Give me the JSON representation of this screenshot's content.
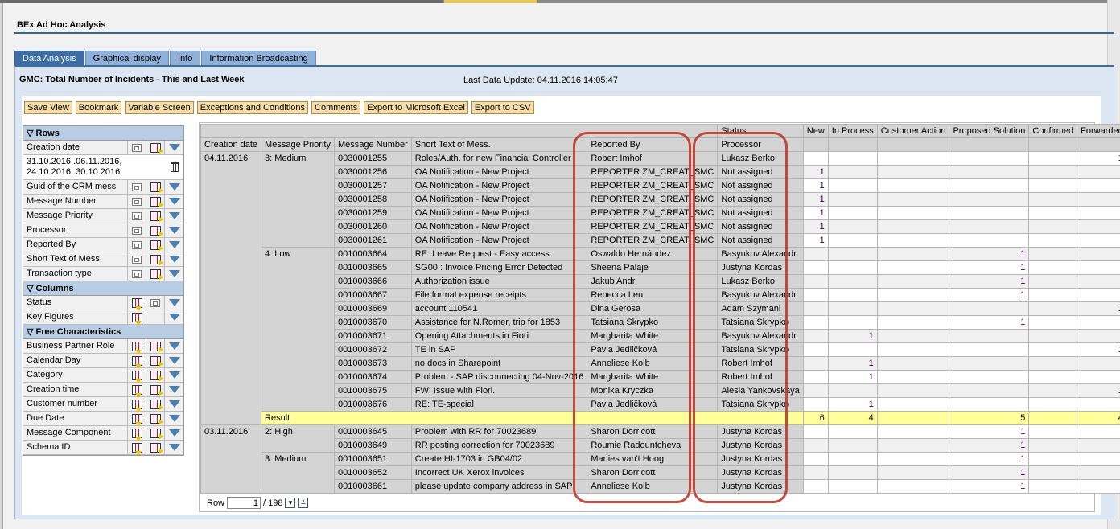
{
  "app_title": "BEx Ad Hoc Analysis",
  "tabs": [
    {
      "label": "Data Analysis",
      "active": true
    },
    {
      "label": "Graphical display"
    },
    {
      "label": "Info"
    },
    {
      "label": "Information Broadcasting"
    }
  ],
  "query_title": "GMC: Total Number of Incidents - This and Last Week",
  "last_update": "Last Data Update: 04.11.2016 14:05:47",
  "toolbar": [
    "Save View",
    "Bookmark",
    "Variable Screen",
    "Exceptions and Conditions",
    "Comments",
    "Export to Microsoft Excel",
    "Export to CSV"
  ],
  "nav": {
    "rows_label": "Rows",
    "rows": [
      "Creation date",
      "Guid of the CRM mess",
      "Message Number",
      "Message Priority",
      "Processor",
      "Reported By",
      "Short Text of Mess.",
      "Transaction type"
    ],
    "creation_filter": [
      "31.10.2016..06.11.2016,",
      "24.10.2016..30.10.2016"
    ],
    "columns_label": "Columns",
    "columns": [
      "Status",
      "Key Figures"
    ],
    "free_label": "Free Characteristics",
    "free": [
      "Business Partner Role",
      "Calendar Day",
      "Category",
      "Creation time",
      "Customer number",
      "Due Date",
      "Message Component",
      "Schema ID"
    ]
  },
  "grid": {
    "status_label": "Status",
    "row_headers": [
      "Creation date",
      "Message Priority",
      "Message Number",
      "Short Text of Mess.",
      "Reported By",
      "Processor"
    ],
    "status_columns": [
      "New",
      "In Process",
      "Customer Action",
      "Proposed Solution",
      "Confirmed",
      "Forwarded"
    ],
    "result_label": "Result",
    "groups": [
      {
        "date": "04.11.2016",
        "priorities": [
          {
            "priority": "3: Medium",
            "rows": [
              [
                "0030001255",
                "Roles/Auth. for new Financial Controller",
                "Robert Imhof",
                "Lukasz Berko",
                [
                  "",
                  "",
                  "",
                  "",
                  "",
                  "1"
                ]
              ],
              [
                "0030001256",
                "OA Notification - New Project",
                "REPORTER ZM_CREAT_SMC",
                "Not assigned",
                [
                  "1",
                  "",
                  "",
                  "",
                  "",
                  ""
                ]
              ],
              [
                "0030001257",
                "OA Notification - New Project",
                "REPORTER ZM_CREAT_SMC",
                "Not assigned",
                [
                  "1",
                  "",
                  "",
                  "",
                  "",
                  ""
                ]
              ],
              [
                "0030001258",
                "OA Notification - New Project",
                "REPORTER ZM_CREAT_SMC",
                "Not assigned",
                [
                  "1",
                  "",
                  "",
                  "",
                  "",
                  ""
                ]
              ],
              [
                "0030001259",
                "OA Notification - New Project",
                "REPORTER ZM_CREAT_SMC",
                "Not assigned",
                [
                  "1",
                  "",
                  "",
                  "",
                  "",
                  ""
                ]
              ],
              [
                "0030001260",
                "OA Notification - New Project",
                "REPORTER ZM_CREAT_SMC",
                "Not assigned",
                [
                  "1",
                  "",
                  "",
                  "",
                  "",
                  ""
                ]
              ],
              [
                "0030001261",
                "OA Notification - New Project",
                "REPORTER ZM_CREAT_SMC",
                "Not assigned",
                [
                  "1",
                  "",
                  "",
                  "",
                  "",
                  ""
                ]
              ]
            ]
          },
          {
            "priority": "4: Low",
            "rows": [
              [
                "0010003664",
                "RE: Leave Request - Easy access",
                "Oswaldo Hernández",
                "Basyukov Alexandr",
                [
                  "",
                  "",
                  "",
                  "1",
                  "",
                  ""
                ]
              ],
              [
                "0010003665",
                "SG00 : Invoice Pricing Error Detected",
                "Sheena Palaje",
                "Justyna Kordas",
                [
                  "",
                  "",
                  "",
                  "1",
                  "",
                  ""
                ]
              ],
              [
                "0010003666",
                "Authorization issue",
                "Jakub Andr",
                "Lukasz Berko",
                [
                  "",
                  "",
                  "",
                  "1",
                  "",
                  ""
                ]
              ],
              [
                "0010003667",
                "File format expense receipts",
                "Rebecca Leu",
                "Basyukov Alexandr",
                [
                  "",
                  "",
                  "",
                  "1",
                  "",
                  ""
                ]
              ],
              [
                "0010003669",
                "account 110541",
                "Dina Gerosa",
                "Adam Szymani",
                [
                  "",
                  "",
                  "",
                  "",
                  "",
                  "1"
                ]
              ],
              [
                "0010003670",
                "Assistance for N.Romer, trip for 1853",
                "Tatsiana Skrypko",
                "Tatsiana Skrypko",
                [
                  "",
                  "",
                  "",
                  "1",
                  "",
                  ""
                ]
              ],
              [
                "0010003671",
                "Opening Attachments in Fiori",
                "Margharita White",
                "Basyukov Alexandr",
                [
                  "",
                  "1",
                  "",
                  "",
                  "",
                  ""
                ]
              ],
              [
                "0010003672",
                "TE in SAP",
                "Pavla Jedličková",
                "Tatsiana Skrypko",
                [
                  "",
                  "",
                  "",
                  "",
                  "",
                  "1"
                ]
              ],
              [
                "0010003673",
                "no docs in Sharepoint",
                "Anneliese Kolb",
                "Robert Imhof",
                [
                  "",
                  "1",
                  "",
                  "",
                  "",
                  ""
                ]
              ],
              [
                "0010003674",
                "Problem - SAP disconnecting 04-Nov-2016",
                "Margharita White",
                "Robert Imhof",
                [
                  "",
                  "1",
                  "",
                  "",
                  "",
                  ""
                ]
              ],
              [
                "0010003675",
                "FW: Issue with Fiori.",
                "Monika Kryczka",
                "Alesia Yankovskaya",
                [
                  "",
                  "",
                  "",
                  "",
                  "",
                  "1"
                ]
              ],
              [
                "0010003676",
                "RE: TE-special",
                "Pavla Jedličková",
                "Tatsiana Skrypko",
                [
                  "",
                  "1",
                  "",
                  "",
                  "",
                  ""
                ]
              ]
            ]
          }
        ],
        "result": [
          "6",
          "4",
          "",
          "5",
          "",
          "4"
        ]
      },
      {
        "date": "03.11.2016",
        "priorities": [
          {
            "priority": "2: High",
            "rows": [
              [
                "0010003645",
                "Problem with RR for 70023689",
                "Sharon Dorricott",
                "Justyna Kordas",
                [
                  "",
                  "",
                  "",
                  "1",
                  "",
                  ""
                ]
              ],
              [
                "0010003649",
                "RR posting correction for 70023689",
                "Roumie Radountcheva",
                "Justyna Kordas",
                [
                  "",
                  "",
                  "",
                  "1",
                  "",
                  ""
                ]
              ]
            ]
          },
          {
            "priority": "3: Medium",
            "rows": [
              [
                "0010003651",
                "Create HI-1703 in GB04/02",
                "Marlies van't Hoog",
                "Justyna Kordas",
                [
                  "",
                  "",
                  "",
                  "1",
                  "",
                  ""
                ]
              ],
              [
                "0010003652",
                "Incorrect UK Xerox invoices",
                "Sharon Dorricott",
                "Justyna Kordas",
                [
                  "",
                  "",
                  "",
                  "1",
                  "",
                  ""
                ]
              ],
              [
                "0010003661",
                "please update company address in SAP",
                "Anneliese Kolb",
                "Justyna Kordas",
                [
                  "",
                  "",
                  "",
                  "1",
                  "",
                  ""
                ]
              ]
            ]
          }
        ]
      }
    ]
  },
  "pager": {
    "label": "Row",
    "value": "1",
    "total": "/ 198"
  },
  "highlight_color": "#c0392b"
}
